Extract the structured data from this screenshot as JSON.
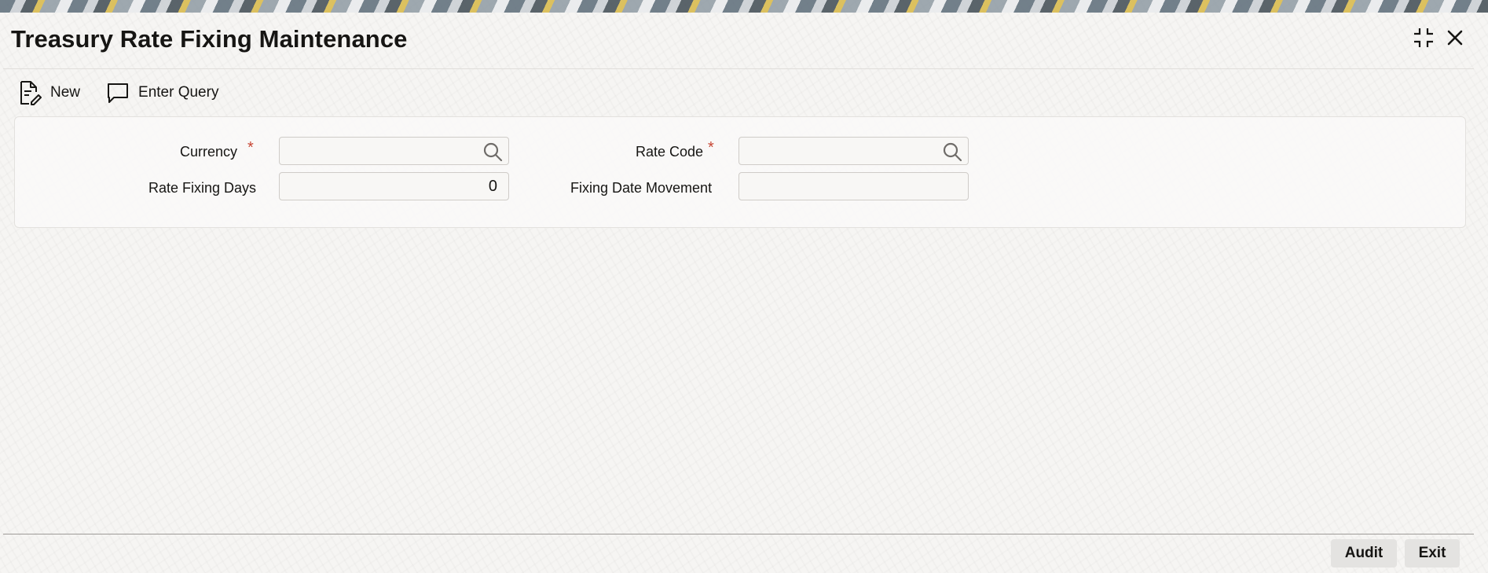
{
  "window": {
    "title": "Treasury Rate Fixing Maintenance"
  },
  "toolbar": {
    "new_label": "New",
    "enter_query_label": "Enter Query"
  },
  "form": {
    "currency": {
      "label": "Currency",
      "required_mark": "*",
      "value": ""
    },
    "rate_code": {
      "label": "Rate Code",
      "required_mark": "*",
      "value": ""
    },
    "rate_fixing_days": {
      "label": "Rate Fixing Days",
      "value": "0"
    },
    "fixing_date_movement": {
      "label": "Fixing Date Movement",
      "value": ""
    }
  },
  "footer": {
    "audit_label": "Audit",
    "exit_label": "Exit"
  },
  "colors": {
    "required": "#c74634",
    "text": "#161513",
    "field_border": "#cfccc8"
  },
  "icons": {
    "new": "new-document-icon",
    "enter_query": "chat-bubble-icon",
    "minimize": "minimize-icon",
    "close": "close-icon",
    "search": "search-icon"
  }
}
